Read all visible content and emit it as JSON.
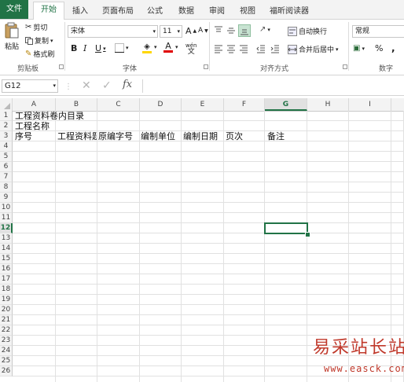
{
  "ribbon_tabs": {
    "file": "文件",
    "active": "开始",
    "others": [
      "插入",
      "页面布局",
      "公式",
      "数据",
      "审阅",
      "视图",
      "福昕阅读器"
    ]
  },
  "clipboard": {
    "paste": "粘贴",
    "cut": "剪切",
    "copy": "复制",
    "format_painter": "格式刷",
    "group_label": "剪贴板"
  },
  "font": {
    "name": "宋体",
    "size": "11",
    "grow": "A",
    "shrink": "A",
    "bold": "B",
    "italic": "I",
    "underline": "U",
    "font_color_letter": "A",
    "wen": "wén",
    "group_label": "字体",
    "accent_fill": "#ffd700",
    "accent_font": "#e00000"
  },
  "alignment": {
    "wrap_text": "自动换行",
    "merge_center": "合并后居中",
    "group_label": "对齐方式"
  },
  "number": {
    "format": "常规",
    "percent": "%",
    "comma": ",",
    "group_label": "数字"
  },
  "formula_bar": {
    "name_box": "G12",
    "fx": "fx",
    "value": ""
  },
  "sheet": {
    "columns": [
      "A",
      "B",
      "C",
      "D",
      "E",
      "F",
      "G",
      "H",
      "I"
    ],
    "selected_column": "G",
    "rows": [
      "1",
      "2",
      "3",
      "4",
      "5",
      "6",
      "7",
      "8",
      "9",
      "10",
      "11",
      "12",
      "13",
      "14",
      "15",
      "16",
      "17",
      "18",
      "19",
      "20",
      "21",
      "22",
      "23",
      "24",
      "25",
      "26"
    ],
    "selected_row": "12",
    "cells": {
      "a1": "工程资料卷内目录",
      "a2": "工程名称",
      "a3": "序号",
      "b3": "工程资料题名",
      "c3": "原编字号",
      "d3": "编制单位",
      "e3": "编制日期",
      "f3": "页次",
      "g3": "备注"
    }
  },
  "watermark": {
    "title": "易采站长站",
    "url": "www.easck.com"
  },
  "colors": {
    "excel_green": "#217346",
    "watermark_red": "#c0392b"
  }
}
